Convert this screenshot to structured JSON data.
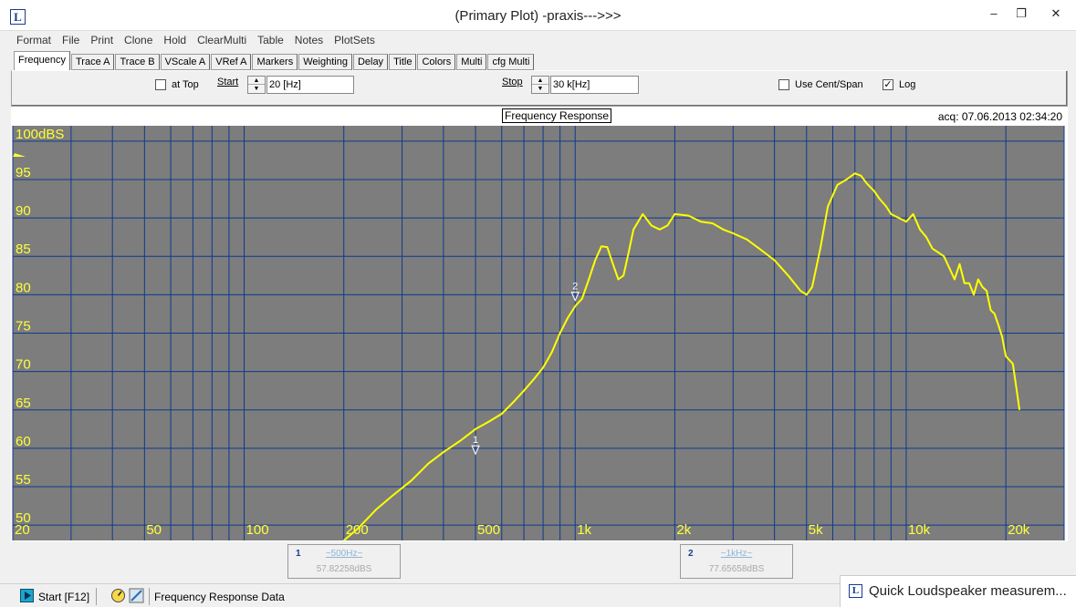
{
  "window": {
    "title": "(Primary Plot) -praxis--->>>",
    "app_icon": "L",
    "controls": [
      "minimize-icon",
      "restore-icon",
      "close-icon"
    ],
    "minimize_glyph": "–",
    "restore_glyph": "❐",
    "close_glyph": "✕"
  },
  "menu": {
    "items": [
      "Format",
      "File",
      "Print",
      "Clone",
      "Hold",
      "ClearMulti",
      "Table",
      "Notes",
      "PlotSets"
    ]
  },
  "tabs": {
    "active": "Frequency",
    "items": [
      "Frequency",
      "Trace A",
      "Trace B",
      "VScale A",
      "VRef A",
      "Markers",
      "Weighting",
      "Delay",
      "Title",
      "Colors",
      "Multi",
      "cfg Multi"
    ]
  },
  "frequency_tab": {
    "at_top_label": "at Top",
    "at_top_checked": false,
    "start_label": "Start",
    "start_value": "20 [Hz]",
    "stop_label": "Stop",
    "stop_value": "30 k[Hz]",
    "use_cent_span_label": "Use Cent/Span",
    "use_cent_span_checked": false,
    "log_label": "Log",
    "log_checked": true,
    "check_glyph": "✓"
  },
  "plot": {
    "title": "Frequency Response",
    "acq_text": "acq: 07.06.2013 02:34:20",
    "y_top_label": "100dBS",
    "y_labels": [
      "95",
      "90",
      "85",
      "80",
      "75",
      "70",
      "65",
      "60",
      "55",
      "50"
    ],
    "x_labels": [
      "20",
      "50",
      "100",
      "200",
      "500",
      "1k",
      "2k",
      "5k",
      "10k",
      "20k"
    ],
    "colors": {
      "plot_background": "#7d7d7d",
      "grid": "#0d3a8f",
      "trace": "#ffff00",
      "axis_text": "#ffff3a"
    }
  },
  "chart_data": {
    "type": "line",
    "title": "Frequency Response",
    "xlabel": "",
    "ylabel": "",
    "x_scale": "log",
    "xlim": [
      20,
      30000
    ],
    "ylim": [
      48,
      102
    ],
    "grid": true,
    "x_ticks": [
      "20",
      "50",
      "100",
      "200",
      "500",
      "1k",
      "2k",
      "5k",
      "10k",
      "20k"
    ],
    "y_ticks": [
      "100dBS",
      "95",
      "90",
      "85",
      "80",
      "75",
      "70",
      "65",
      "60",
      "55",
      "50"
    ],
    "series": [
      {
        "color": "#ffff00",
        "x": [
          200,
          220,
          250,
          280,
          320,
          360,
          400,
          450,
          500,
          550,
          600,
          650,
          700,
          750,
          800,
          850,
          900,
          950,
          1000,
          1050,
          1100,
          1150,
          1200,
          1250,
          1300,
          1350,
          1400,
          1450,
          1500,
          1600,
          1700,
          1800,
          1900,
          2000,
          2200,
          2400,
          2600,
          2800,
          3000,
          3300,
          3600,
          4000,
          4400,
          4800,
          5000,
          5200,
          5500,
          5800,
          6200,
          6600,
          7000,
          7300,
          7600,
          8000,
          8300,
          8700,
          9000,
          9500,
          10000,
          10500,
          11000,
          11500,
          12000,
          12500,
          13000,
          13500,
          14000,
          14500,
          15000,
          15500,
          16000,
          16500,
          17000,
          17500,
          18000,
          18500,
          19000,
          19500,
          20000,
          20500,
          21000,
          21500,
          22000
        ],
        "values": [
          47.8,
          49.5,
          52.0,
          53.8,
          55.8,
          58.0,
          59.5,
          61.0,
          62.5,
          63.5,
          64.5,
          66.0,
          67.5,
          69.0,
          70.5,
          72.5,
          75.0,
          77.0,
          78.5,
          79.5,
          82.0,
          84.5,
          86.3,
          86.2,
          84.0,
          82.0,
          82.5,
          85.5,
          88.5,
          90.5,
          89.0,
          88.5,
          89.0,
          90.5,
          90.3,
          89.5,
          89.3,
          88.5,
          88.0,
          87.2,
          86.0,
          84.5,
          82.5,
          80.5,
          80.0,
          81.0,
          86.0,
          91.5,
          94.3,
          95.0,
          95.8,
          95.5,
          94.5,
          93.5,
          92.5,
          91.5,
          90.5,
          90.0,
          89.5,
          90.5,
          88.5,
          87.5,
          86.0,
          85.5,
          85.0,
          83.5,
          82.0,
          84.0,
          81.5,
          81.5,
          80.0,
          82.0,
          81.0,
          80.5,
          78.0,
          77.5,
          76.0,
          74.5,
          72.0,
          71.5,
          71.0,
          68.0,
          65.0
        ]
      }
    ],
    "annotations": [
      {
        "label": "1",
        "x": 500,
        "y": 59.5
      },
      {
        "label": "2",
        "x": 1000,
        "y": 79.5
      }
    ]
  },
  "markers": [
    {
      "num": "1",
      "freq": "~500Hz~",
      "level": "57.82258dBS"
    },
    {
      "num": "2",
      "freq": "~1kHz~",
      "level": "77.65658dBS"
    }
  ],
  "statusbar": {
    "start_label": "Start [F12]",
    "data_label": "Frequency Response Data",
    "start_icon": "play-icon",
    "gauge_icon": "gauge-icon",
    "tool_icon": "tool-icon"
  },
  "taskbar_notice": {
    "text": "Quick Loudspeaker measurem..."
  }
}
